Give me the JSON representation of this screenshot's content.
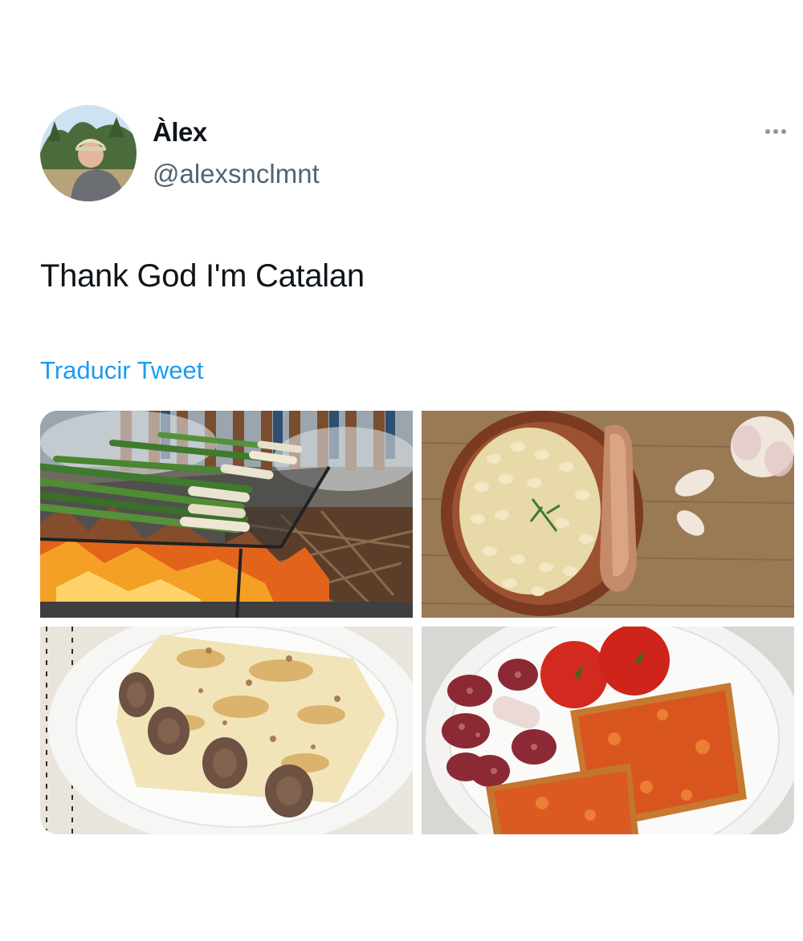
{
  "tweet": {
    "author": {
      "display_name": "Àlex",
      "handle": "@alexsnclmnt"
    },
    "text": "Thank God I'm Catalan",
    "translate_label": "Traducir Tweet",
    "more_icon": "ellipsis-icon"
  },
  "media": [
    {
      "subject": "calçots grilling over open fire"
    },
    {
      "subject": "white beans with botifarra sausage"
    },
    {
      "subject": "canelons with béchamel"
    },
    {
      "subject": "pa amb tomàquet with fuet and tomatoes"
    }
  ]
}
